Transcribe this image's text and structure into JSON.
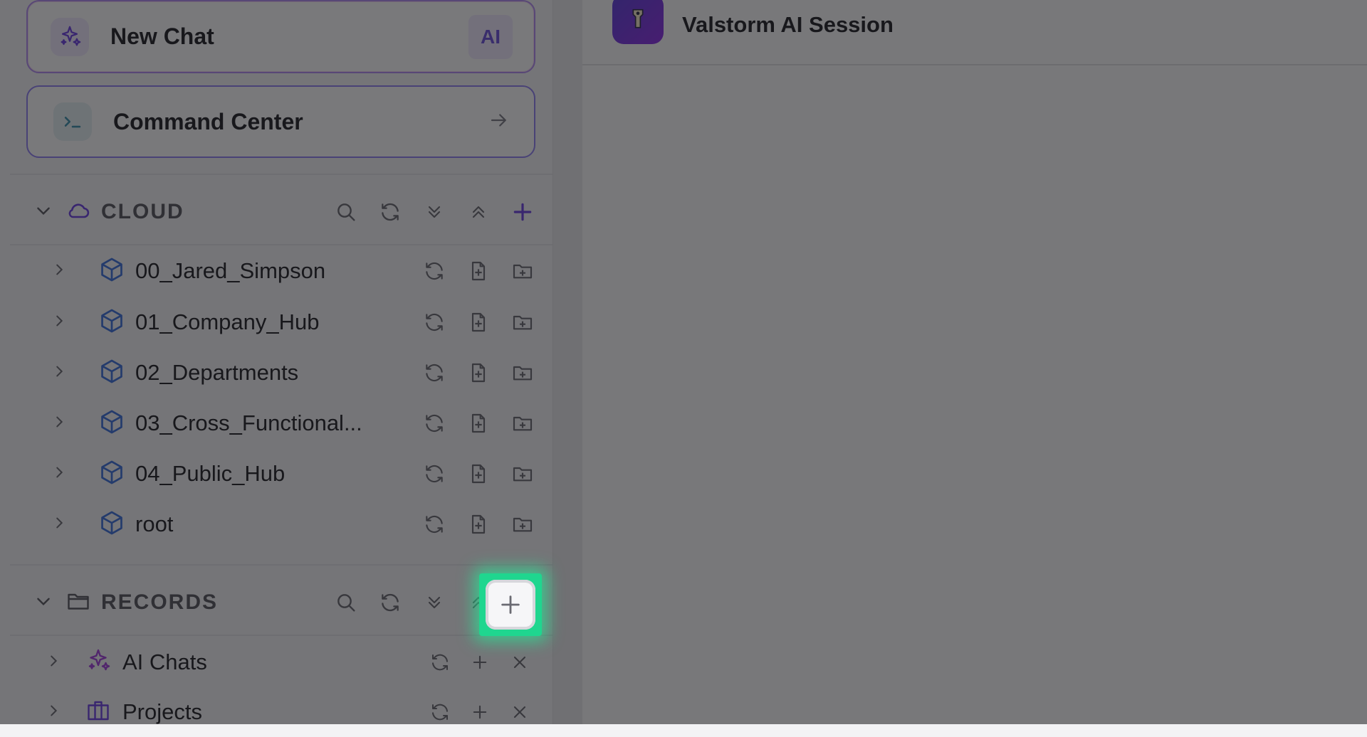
{
  "sidebar": {
    "new_chat": {
      "label": "New Chat",
      "badge": "AI"
    },
    "command_center": {
      "label": "Command Center"
    },
    "cloud": {
      "title": "CLOUD",
      "items": [
        {
          "label": "00_Jared_Simpson"
        },
        {
          "label": "01_Company_Hub"
        },
        {
          "label": "02_Departments"
        },
        {
          "label": "03_Cross_Functional..."
        },
        {
          "label": "04_Public_Hub"
        },
        {
          "label": "root"
        }
      ]
    },
    "records": {
      "title": "RECORDS",
      "items": [
        {
          "label": "AI Chats"
        },
        {
          "label": "Projects"
        }
      ]
    }
  },
  "main": {
    "title": "Valstorm AI Session"
  },
  "colors": {
    "accent": "#6a3fe0",
    "highlight": "#1fd68f",
    "cube": "#3a6fd8"
  }
}
